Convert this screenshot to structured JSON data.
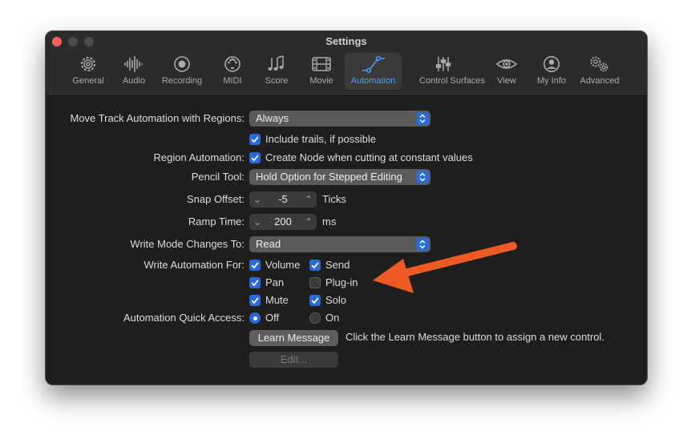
{
  "window": {
    "title": "Settings"
  },
  "toolbar": {
    "tabs": [
      {
        "label": "General",
        "icon": "gear-icon"
      },
      {
        "label": "Audio",
        "icon": "waveform-icon"
      },
      {
        "label": "Recording",
        "icon": "record-icon"
      },
      {
        "label": "MIDI",
        "icon": "midi-port-icon"
      },
      {
        "label": "Score",
        "icon": "music-notes-icon"
      },
      {
        "label": "Movie",
        "icon": "film-icon"
      },
      {
        "label": "Automation",
        "icon": "automation-curve-icon",
        "active": true
      },
      {
        "label": "Control Surfaces",
        "icon": "sliders-icon"
      },
      {
        "label": "View",
        "icon": "eye-icon"
      },
      {
        "label": "My Info",
        "icon": "person-icon"
      },
      {
        "label": "Advanced",
        "icon": "gears-icon"
      }
    ]
  },
  "settings": {
    "move_track_automation": {
      "label": "Move Track Automation with Regions:",
      "value": "Always"
    },
    "include_trails": {
      "label": "Include trails, if possible",
      "checked": true
    },
    "region_automation": {
      "label": "Region Automation:",
      "option_label": "Create Node when cutting at constant values",
      "checked": true
    },
    "pencil_tool": {
      "label": "Pencil Tool:",
      "value": "Hold Option for Stepped Editing"
    },
    "snap_offset": {
      "label": "Snap Offset:",
      "value": "-5",
      "unit": "Ticks"
    },
    "ramp_time": {
      "label": "Ramp Time:",
      "value": "200",
      "unit": "ms"
    },
    "write_mode_changes": {
      "label": "Write Mode Changes To:",
      "value": "Read"
    },
    "write_automation_for": {
      "label": "Write Automation For:",
      "options": [
        {
          "label": "Volume",
          "checked": true
        },
        {
          "label": "Send",
          "checked": true
        },
        {
          "label": "Pan",
          "checked": true
        },
        {
          "label": "Plug-in",
          "checked": false
        },
        {
          "label": "Mute",
          "checked": true
        },
        {
          "label": "Solo",
          "checked": true
        }
      ]
    },
    "quick_access": {
      "label": "Automation Quick Access:",
      "options": [
        {
          "label": "Off",
          "selected": true
        },
        {
          "label": "On",
          "selected": false
        }
      ]
    },
    "learn_message": {
      "button_label": "Learn Message",
      "hint": "Click the Learn Message button to assign a new control."
    },
    "edit": {
      "button_label": "Edit..."
    }
  },
  "annotation": {
    "color": "#ee5a24"
  },
  "colors": {
    "accent": "#2a6ad6",
    "active_tab_label": "#4d9bff",
    "close": "#ff5f57"
  }
}
